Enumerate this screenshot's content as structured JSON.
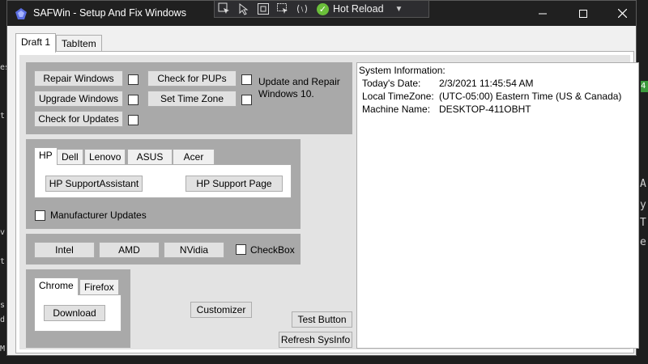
{
  "window": {
    "title": "SAFWin - Setup And Fix Windows",
    "controls": {
      "minimize": "—",
      "maximize": "☐",
      "close": "✕"
    }
  },
  "debug_toolbar": {
    "hot_reload_label": "Hot Reload",
    "icons": [
      "select-element-icon",
      "cursor-select-icon",
      "layout-adorner-icon",
      "track-focus-icon",
      "binding-failures-icon"
    ]
  },
  "tabs": [
    "Draft 1",
    "TabItem"
  ],
  "top_panel": {
    "repair_windows": "Repair Windows",
    "upgrade_windows": "Upgrade Windows",
    "check_for_updates": "Check for Updates",
    "check_for_pups": "Check for PUPs",
    "set_time_zone": "Set Time Zone",
    "update_repair_text": "Update and Repair Windows 10."
  },
  "manufacturer_panel": {
    "tabs": [
      "HP",
      "Dell",
      "Lenovo",
      "ASUS",
      "Acer"
    ],
    "hp_support_assistant": "HP SupportAssistant",
    "hp_support_page": "HP Support Page",
    "manufacturer_updates": "Manufacturer Updates"
  },
  "driver_panel": {
    "intel": "Intel",
    "amd": "AMD",
    "nvidia": "NVidia",
    "checkbox_label": "CheckBox"
  },
  "browser_panel": {
    "tabs": [
      "Chrome",
      "Firefox"
    ],
    "download": "Download"
  },
  "buttons": {
    "customizer": "Customizer",
    "test_button": "Test Button",
    "refresh_sysinfo": "Refresh SysInfo"
  },
  "system_info": {
    "heading": "System Information:",
    "rows": [
      {
        "label": "Today's Date:",
        "value": "2/3/2021 11:45:54 AM"
      },
      {
        "label": "Local TimeZone:",
        "value": "(UTC-05:00) Eastern Time (US & Canada)"
      },
      {
        "label": "Machine Name:",
        "value": "DESKTOP-411OBHT"
      }
    ]
  },
  "background": {
    "left_glyphs": [
      "es",
      "t",
      "v",
      "t",
      "s",
      "d",
      "M"
    ],
    "right_glyphs": [
      "A",
      "y",
      "T",
      "e"
    ],
    "right_tag": "4"
  },
  "colors": {
    "titlebar": "#202020",
    "panel_gray": "#a9a9a9",
    "hot_reload_green": "#6bbf3a"
  }
}
